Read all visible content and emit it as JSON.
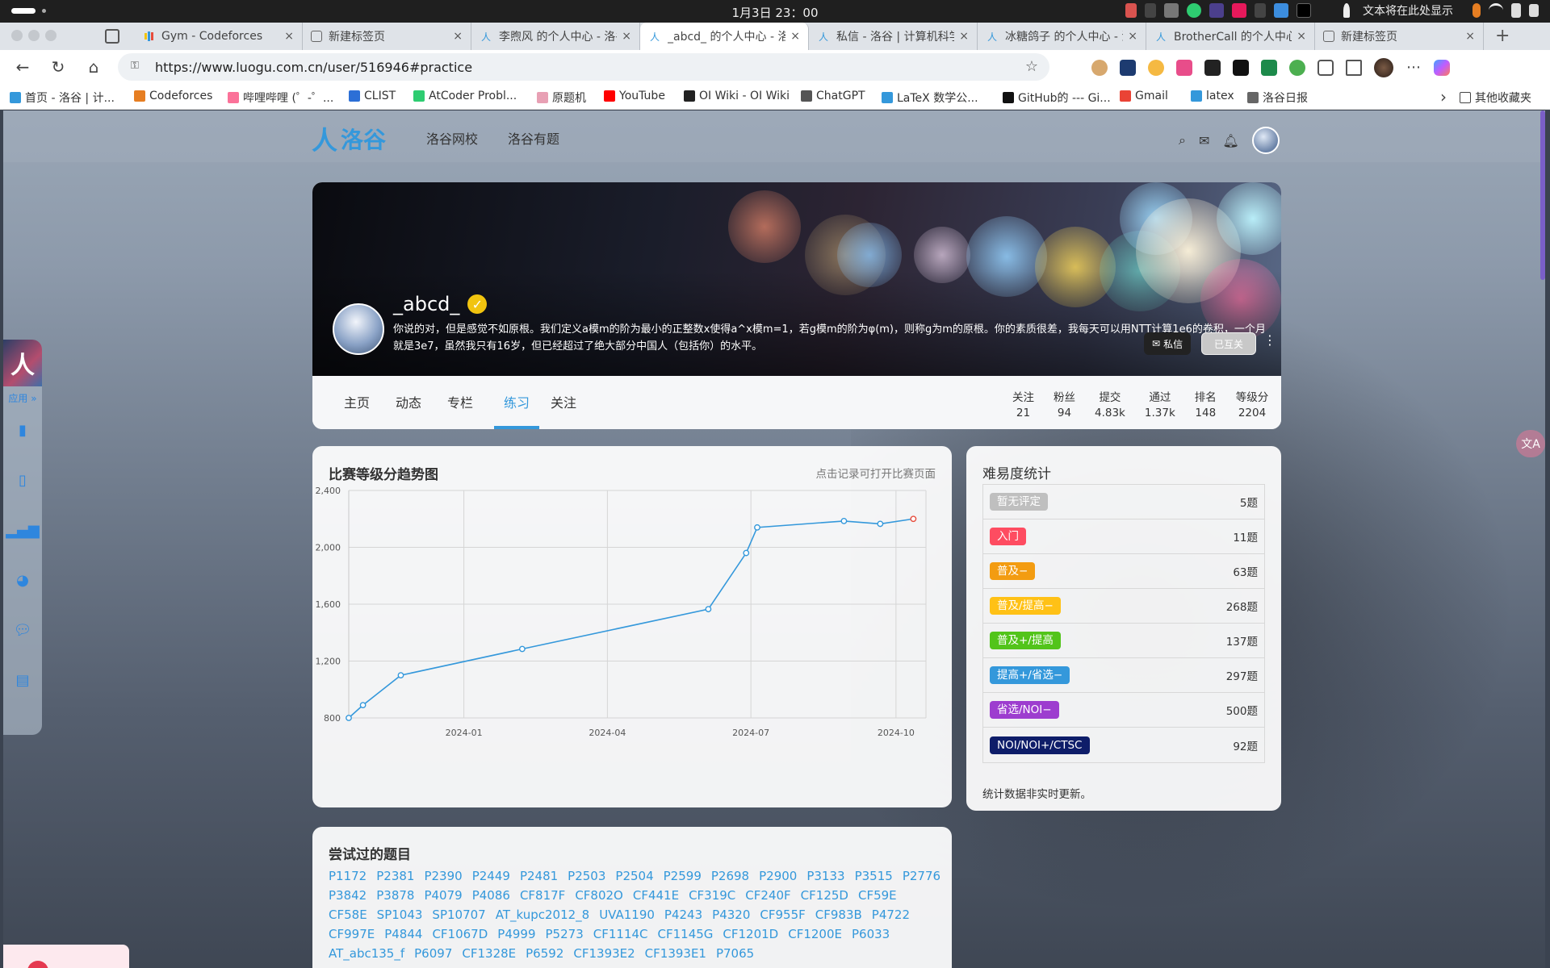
{
  "os": {
    "clock": "1月3日  23：00",
    "input_hint": "文本将在此处显示"
  },
  "tabs": [
    {
      "title": "Gym - Codeforces",
      "icon": "codeforces-icon",
      "active": false
    },
    {
      "title": "新建标签页",
      "icon": "newtab-icon",
      "active": false
    },
    {
      "title": "李煦风 的个人中心 - 洛谷",
      "icon": "luogu-icon",
      "active": false
    },
    {
      "title": "_abcd_ 的个人中心 - 洛谷",
      "icon": "luogu-icon",
      "active": true
    },
    {
      "title": "私信 - 洛谷 | 计算机科学",
      "icon": "luogu-icon",
      "active": false
    },
    {
      "title": "冰糖鸽子 的个人中心 - 洛谷",
      "icon": "luogu-icon",
      "active": false
    },
    {
      "title": "BrotherCall 的个人中心 - 洛谷",
      "icon": "luogu-icon",
      "active": false
    },
    {
      "title": "新建标签页",
      "icon": "newtab-icon",
      "active": false
    }
  ],
  "address": {
    "url": "https://www.luogu.com.cn/user/516946#practice"
  },
  "bookmarks": [
    {
      "label": "首页 - 洛谷 | 计...",
      "color": "#3498db"
    },
    {
      "label": "Codeforces",
      "color": "#e67e22"
    },
    {
      "label": "哔哩哔哩 (゜-゜...",
      "color": "#fb7299"
    },
    {
      "label": "CLIST",
      "color": "#2c6fd6"
    },
    {
      "label": "AtCoder Probl...",
      "color": "#2ecc71"
    },
    {
      "label": "原题机",
      "color": "#e8a0b4"
    },
    {
      "label": "YouTube",
      "color": "#ff0000"
    },
    {
      "label": "OI Wiki - OI Wiki",
      "color": "#222222"
    },
    {
      "label": "ChatGPT",
      "color": "#555555"
    },
    {
      "label": "LaTeX 数学公...",
      "color": "#3498db"
    },
    {
      "label": "GitHub的 --- Gi...",
      "color": "#111111"
    },
    {
      "label": "Gmail",
      "color": "#ea4335"
    },
    {
      "label": "latex",
      "color": "#3498db"
    },
    {
      "label": "洛谷日报",
      "color": "#666666"
    }
  ],
  "bookmarks_other": "其他收藏夹",
  "site": {
    "logo": "洛谷",
    "nav": [
      "洛谷网校",
      "洛谷有题"
    ]
  },
  "dock": {
    "label": "应用 »",
    "icons": [
      "book-icon",
      "clipboard-icon",
      "bar-chart-icon",
      "pie-chart-icon",
      "chat-icon",
      "news-icon"
    ]
  },
  "profile": {
    "username": "_abcd_",
    "bio": "你说的对，但是感觉不如原根。我们定义a模m的阶为最小的正整数x使得a^x模m=1，若g模m的阶为φ(m)，则称g为m的原根。你的素质很差，我每天可以用NTT计算1e6的卷积，一个月就是3e7，虽然我只有16岁，但已经超过了绝大部分中国人（包括你）的水平。",
    "pm_label": "私信",
    "follow_label": "已互关",
    "tabs": [
      "主页",
      "动态",
      "专栏",
      "练习",
      "关注"
    ],
    "active_tab": "练习",
    "stats": [
      {
        "label": "关注",
        "value": "21"
      },
      {
        "label": "粉丝",
        "value": "94"
      },
      {
        "label": "提交",
        "value": "4.83k"
      },
      {
        "label": "通过",
        "value": "1.37k"
      },
      {
        "label": "排名",
        "value": "148"
      },
      {
        "label": "等级分",
        "value": "2204"
      }
    ]
  },
  "chart_card": {
    "title": "比赛等级分趋势图",
    "hint": "点击记录可打开比赛页面"
  },
  "chart_data": {
    "type": "line",
    "title": "比赛等级分趋势图",
    "xlabel": "",
    "ylabel": "",
    "x_ticks": [
      "2024-01",
      "2024-04",
      "2024-07",
      "2024-10"
    ],
    "y_ticks": [
      "800",
      "1,200",
      "1,600",
      "2,000",
      "2,400"
    ],
    "ylim": [
      800,
      2400
    ],
    "x_range": [
      "2023-10-20",
      "2024-10-20"
    ],
    "series": [
      {
        "x": [
          "2023-10-20",
          "2023-10-29",
          "2023-11-22",
          "2024-02-07",
          "2024-06-04",
          "2024-06-28",
          "2024-07-05",
          "2024-08-29",
          "2024-09-21",
          "2024-10-12"
        ],
        "values": [
          800,
          890,
          1100,
          1285,
          1565,
          1960,
          2140,
          2185,
          2165,
          2200
        ],
        "color": "#3498db",
        "last_point_color": "#e74c3c"
      }
    ],
    "grid": true
  },
  "difficulty": {
    "title": "难易度统计",
    "rows": [
      {
        "label": "暂无评定",
        "count": "5题",
        "color": "#bfbfbf"
      },
      {
        "label": "入门",
        "count": "11题",
        "color": "#fe4c61"
      },
      {
        "label": "普及−",
        "count": "63题",
        "color": "#f39c11"
      },
      {
        "label": "普及/提高−",
        "count": "268题",
        "color": "#ffc116"
      },
      {
        "label": "普及+/提高",
        "count": "137题",
        "color": "#52c41a"
      },
      {
        "label": "提高+/省选−",
        "count": "297题",
        "color": "#3498db"
      },
      {
        "label": "省选/NOI−",
        "count": "500题",
        "color": "#9d3dcf"
      },
      {
        "label": "NOI/NOI+/CTSC",
        "count": "92题",
        "color": "#0e1d69"
      }
    ],
    "note": "统计数据非实时更新。"
  },
  "problems": {
    "title": "尝试过的题目",
    "items": [
      "P1172",
      "P2381",
      "P2390",
      "P2449",
      "P2481",
      "P2503",
      "P2504",
      "P2599",
      "P2698",
      "P2900",
      "P3133",
      "P3515",
      "P2776",
      "P3842",
      "P3878",
      "P4079",
      "P4086",
      "CF817F",
      "CF802O",
      "CF441E",
      "CF319C",
      "CF240F",
      "CF125D",
      "CF59E",
      "CF58E",
      "SP1043",
      "SP10707",
      "AT_kupc2012_8",
      "UVA1190",
      "P4243",
      "P4320",
      "CF955F",
      "CF983B",
      "P4722",
      "CF997E",
      "P4844",
      "CF1067D",
      "P4999",
      "P5273",
      "CF1114C",
      "CF1145G",
      "CF1201D",
      "CF1200E",
      "P6033",
      "AT_abc135_f",
      "P6097",
      "CF1328E",
      "P6592",
      "CF1393E2",
      "CF1393E1",
      "P7065"
    ]
  }
}
